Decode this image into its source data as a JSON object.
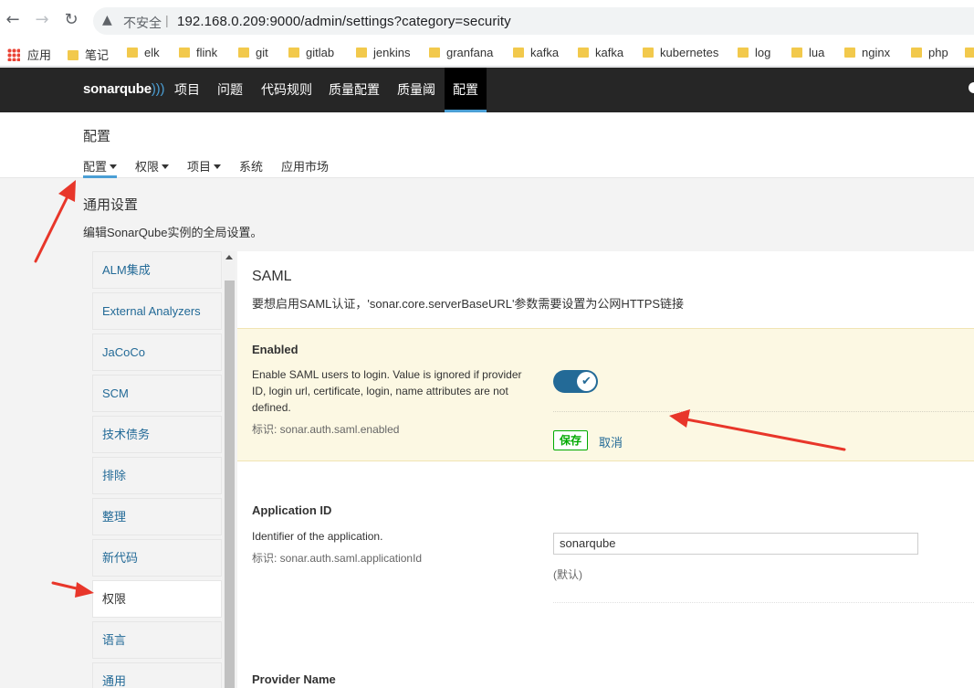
{
  "browser": {
    "back_glyph": "←",
    "forward_glyph": "→",
    "reload_glyph": "↻",
    "warning_glyph": "▲",
    "insecure_label": "不安全",
    "separator": "|",
    "url": "192.168.0.209:9000/admin/settings?category=security"
  },
  "bookmarks": [
    {
      "label": "应用",
      "icon": "apps-grid-icon"
    },
    {
      "label": "笔记",
      "icon": "folder-icon"
    },
    {
      "label": "elk",
      "icon": "folder-icon"
    },
    {
      "label": "flink",
      "icon": "folder-icon"
    },
    {
      "label": "git",
      "icon": "folder-icon"
    },
    {
      "label": "gitlab",
      "icon": "folder-icon"
    },
    {
      "label": "jenkins",
      "icon": "folder-icon"
    },
    {
      "label": "granfana",
      "icon": "folder-icon"
    },
    {
      "label": "kafka",
      "icon": "folder-icon"
    },
    {
      "label": "kafka",
      "icon": "folder-icon"
    },
    {
      "label": "kubernetes",
      "icon": "folder-icon"
    },
    {
      "label": "log",
      "icon": "folder-icon"
    },
    {
      "label": "lua",
      "icon": "folder-icon"
    },
    {
      "label": "nginx",
      "icon": "folder-icon"
    },
    {
      "label": "php",
      "icon": "folder-icon"
    }
  ],
  "navbar": {
    "logo_text": "sonarqube",
    "logo_mark": ")))",
    "items": [
      "项目",
      "问题",
      "代码规则",
      "质量配置",
      "质量阈",
      "配置"
    ],
    "active_item": "配置"
  },
  "header": {
    "title": "配置",
    "subnav": [
      {
        "label": "配置",
        "dropdown": true
      },
      {
        "label": "权限",
        "dropdown": true
      },
      {
        "label": "项目",
        "dropdown": true
      },
      {
        "label": "系统",
        "dropdown": false
      },
      {
        "label": "应用市场",
        "dropdown": false
      }
    ]
  },
  "section": {
    "title": "通用设置",
    "description": "编辑SonarQube实例的全局设置。"
  },
  "sidebar": {
    "items": [
      "ALM集成",
      "External Analyzers",
      "JaCoCo",
      "SCM",
      "技术债务",
      "排除",
      "整理",
      "新代码",
      "权限",
      "语言",
      "通用"
    ],
    "active_item": "权限"
  },
  "main": {
    "title": "SAML",
    "description": "要想启用SAML认证，'sonar.core.serverBaseURL'参数需要设置为公网HTTPS链接",
    "enabled": {
      "name": "Enabled",
      "description_lines": [
        "Enable SAML users to login. Value is ignored if provider",
        "ID, login url, certificate, login, name attributes are not",
        "defined."
      ],
      "key_label": "标识: sonar.auth.saml.enabled",
      "value": true,
      "toggle_glyph": "✔",
      "save_label": "保存",
      "cancel_label": "取消"
    },
    "application_id": {
      "name": "Application ID",
      "description": "Identifier of the application.",
      "key_label": "标识: sonar.auth.saml.applicationId",
      "value": "sonarqube",
      "default_label": "(默认)"
    },
    "provider_name": {
      "name": "Provider Name"
    }
  },
  "colors": {
    "navbar_bg": "#262626",
    "accent": "#4b9fd5",
    "link": "#236a97",
    "highlight_bg": "#fcf8e3",
    "save_green": "#00aa00",
    "annotation_red": "#e8362a"
  }
}
